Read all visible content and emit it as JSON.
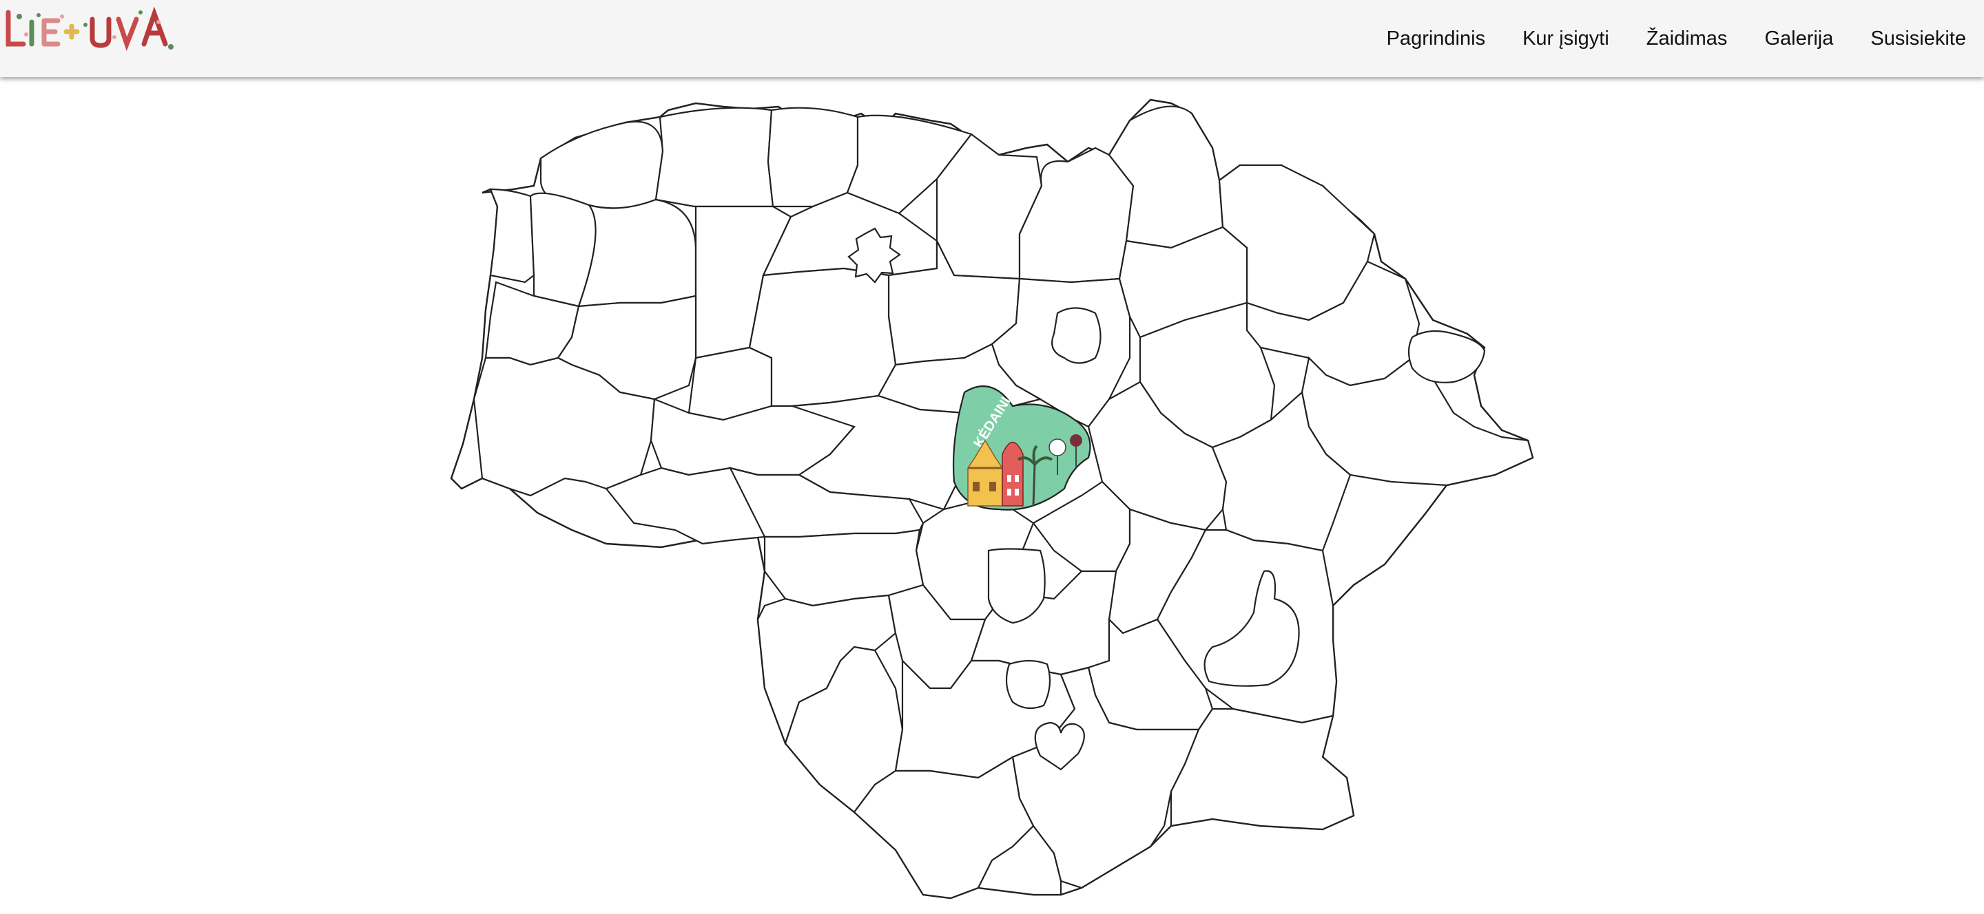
{
  "logo": {
    "text": "LIETUVA",
    "alt": "Lietuva"
  },
  "nav": {
    "items": [
      {
        "label": "Pagrindinis"
      },
      {
        "label": "Kur įsigyti"
      },
      {
        "label": "Žaidimas"
      },
      {
        "label": "Galerija"
      },
      {
        "label": "Susisiekite"
      }
    ]
  },
  "map": {
    "highlighted_region": {
      "label": "KĖDAINIAI",
      "fill": "#7ecfa8"
    }
  },
  "colors": {
    "header_bg": "#f5f5f5",
    "stroke": "#222222",
    "logo_accent": "#c94a4a"
  }
}
